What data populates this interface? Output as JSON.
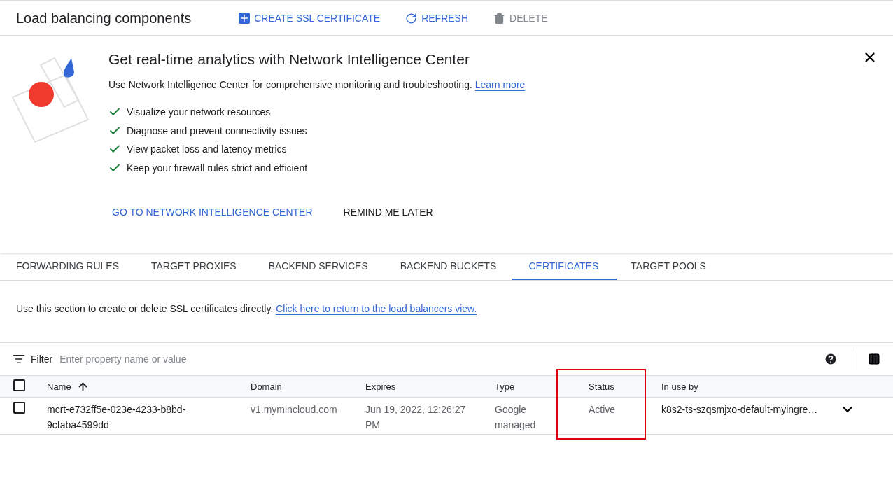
{
  "header": {
    "title": "Load balancing components",
    "actions": [
      {
        "label": "CREATE SSL CERTIFICATE",
        "kind": "add",
        "disabled": false
      },
      {
        "label": "REFRESH",
        "kind": "refresh",
        "disabled": false
      },
      {
        "label": "DELETE",
        "kind": "delete",
        "disabled": true
      }
    ]
  },
  "banner": {
    "title": "Get real-time analytics with Network Intelligence Center",
    "text": "Use Network Intelligence Center for comprehensive monitoring and troubleshooting.",
    "link": "Learn more",
    "features": [
      "Visualize your network resources",
      "Diagnose and prevent connectivity issues",
      "View packet loss and latency metrics",
      "Keep your firewall rules strict and efficient"
    ],
    "primary_action": "GO TO NETWORK INTELLIGENCE CENTER",
    "secondary_action": "REMIND ME LATER"
  },
  "tabs": [
    {
      "label": "FORWARDING RULES",
      "selected": false
    },
    {
      "label": "TARGET PROXIES",
      "selected": false
    },
    {
      "label": "BACKEND SERVICES",
      "selected": false
    },
    {
      "label": "BACKEND BUCKETS",
      "selected": false
    },
    {
      "label": "CERTIFICATES",
      "selected": true
    },
    {
      "label": "TARGET POOLS",
      "selected": false
    }
  ],
  "info": {
    "text": "Use this section to create or delete SSL certificates directly.",
    "link": "Click here to return to the load balancers view."
  },
  "filter": {
    "label": "Filter",
    "placeholder": "Enter property name or value"
  },
  "table": {
    "columns": [
      {
        "label": "Name",
        "sorted": true,
        "highlighted": false
      },
      {
        "label": "Domain",
        "sorted": false,
        "highlighted": false
      },
      {
        "label": "Expires",
        "sorted": false,
        "highlighted": false
      },
      {
        "label": "Type",
        "sorted": false,
        "highlighted": false
      },
      {
        "label": "Status",
        "sorted": false,
        "highlighted": true
      },
      {
        "label": "In use by",
        "sorted": false,
        "highlighted": false
      }
    ],
    "all_checked": false,
    "rows": [
      {
        "checked": false,
        "cells": [
          "mcrt-e732ff5e-023e-4233-b8bd-9cfaba4599dd",
          "v1.mymincloud.com",
          "Jun 19, 2022, 12:26:27 PM",
          "Google managed",
          "Active",
          "k8s2-ts-szqsmjxo-default-myingre…"
        ]
      }
    ]
  }
}
